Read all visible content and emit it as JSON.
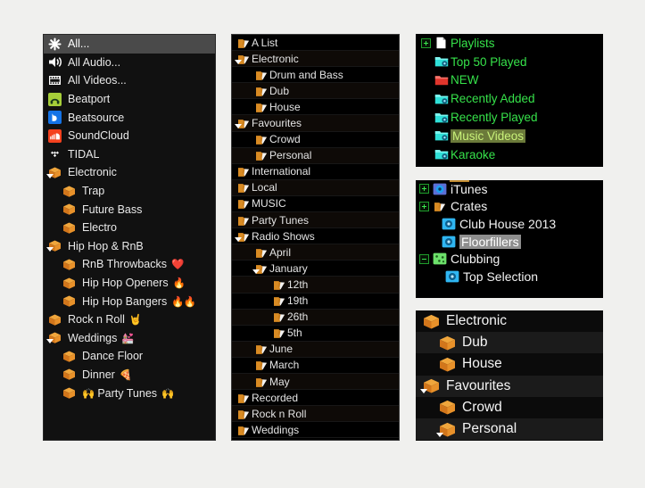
{
  "sources_panel": {
    "rows": [
      {
        "label": "All...",
        "icon": "asterisk-icon",
        "indent": 0,
        "selected": true,
        "arrow": false,
        "emoji": "",
        "emoji_pre": ""
      },
      {
        "label": "All Audio...",
        "icon": "speaker-icon",
        "indent": 0,
        "selected": false,
        "arrow": false,
        "emoji": "",
        "emoji_pre": ""
      },
      {
        "label": "All Videos...",
        "icon": "film-icon",
        "indent": 0,
        "selected": false,
        "arrow": false,
        "emoji": "",
        "emoji_pre": ""
      },
      {
        "label": "Beatport",
        "icon": "beatport-icon",
        "indent": 0,
        "selected": false,
        "arrow": false,
        "emoji": "",
        "emoji_pre": ""
      },
      {
        "label": "Beatsource",
        "icon": "beatsource-icon",
        "indent": 0,
        "selected": false,
        "arrow": false,
        "emoji": "",
        "emoji_pre": ""
      },
      {
        "label": "SoundCloud",
        "icon": "soundcloud-icon",
        "indent": 0,
        "selected": false,
        "arrow": false,
        "emoji": "",
        "emoji_pre": ""
      },
      {
        "label": "TIDAL",
        "icon": "tidal-icon",
        "indent": 0,
        "selected": false,
        "arrow": false,
        "emoji": "",
        "emoji_pre": ""
      },
      {
        "label": "Electronic",
        "icon": "crate-icon",
        "indent": 0,
        "selected": false,
        "arrow": true,
        "emoji": "",
        "emoji_pre": ""
      },
      {
        "label": "Trap",
        "icon": "crate-icon",
        "indent": 1,
        "selected": false,
        "arrow": false,
        "emoji": "",
        "emoji_pre": ""
      },
      {
        "label": "Future Bass",
        "icon": "crate-icon",
        "indent": 1,
        "selected": false,
        "arrow": false,
        "emoji": "",
        "emoji_pre": ""
      },
      {
        "label": "Electro",
        "icon": "crate-icon",
        "indent": 1,
        "selected": false,
        "arrow": false,
        "emoji": "",
        "emoji_pre": ""
      },
      {
        "label": "Hip Hop & RnB",
        "icon": "crate-icon",
        "indent": 0,
        "selected": false,
        "arrow": true,
        "emoji": "",
        "emoji_pre": ""
      },
      {
        "label": "RnB Throwbacks",
        "icon": "crate-icon",
        "indent": 1,
        "selected": false,
        "arrow": false,
        "emoji": "❤️",
        "emoji_pre": ""
      },
      {
        "label": "Hip Hop Openers",
        "icon": "crate-icon",
        "indent": 1,
        "selected": false,
        "arrow": false,
        "emoji": "🔥",
        "emoji_pre": ""
      },
      {
        "label": "Hip Hop Bangers",
        "icon": "crate-icon",
        "indent": 1,
        "selected": false,
        "arrow": false,
        "emoji": "🔥🔥",
        "emoji_pre": ""
      },
      {
        "label": "Rock n Roll",
        "icon": "crate-icon",
        "indent": 0,
        "selected": false,
        "arrow": false,
        "emoji": "🤘",
        "emoji_pre": ""
      },
      {
        "label": "Weddings",
        "icon": "crate-icon",
        "indent": 0,
        "selected": false,
        "arrow": true,
        "emoji": "💒",
        "emoji_pre": ""
      },
      {
        "label": "Dance Floor",
        "icon": "crate-icon",
        "indent": 1,
        "selected": false,
        "arrow": false,
        "emoji": "",
        "emoji_pre": ""
      },
      {
        "label": "Dinner",
        "icon": "crate-icon",
        "indent": 1,
        "selected": false,
        "arrow": false,
        "emoji": "🍕",
        "emoji_pre": ""
      },
      {
        "label": "Party Tunes",
        "icon": "crate-icon",
        "indent": 1,
        "selected": false,
        "arrow": false,
        "emoji": "🙌",
        "emoji_pre": "🙌"
      }
    ]
  },
  "crates_panel": {
    "rows": [
      {
        "label": "A List",
        "indent": 0,
        "arrow": false
      },
      {
        "label": "Electronic",
        "indent": 0,
        "arrow": true
      },
      {
        "label": "Drum and Bass",
        "indent": 1,
        "arrow": false
      },
      {
        "label": "Dub",
        "indent": 1,
        "arrow": false
      },
      {
        "label": "House",
        "indent": 1,
        "arrow": false
      },
      {
        "label": "Favourites",
        "indent": 0,
        "arrow": true
      },
      {
        "label": "Crowd",
        "indent": 1,
        "arrow": false
      },
      {
        "label": "Personal",
        "indent": 1,
        "arrow": false
      },
      {
        "label": "International",
        "indent": 0,
        "arrow": false
      },
      {
        "label": "Local",
        "indent": 0,
        "arrow": false
      },
      {
        "label": "MUSIC",
        "indent": 0,
        "arrow": false
      },
      {
        "label": "Party Tunes",
        "indent": 0,
        "arrow": false
      },
      {
        "label": "Radio Shows",
        "indent": 0,
        "arrow": true
      },
      {
        "label": "April",
        "indent": 1,
        "arrow": false
      },
      {
        "label": "January",
        "indent": 1,
        "arrow": true
      },
      {
        "label": "12th",
        "indent": 2,
        "arrow": false
      },
      {
        "label": "19th",
        "indent": 2,
        "arrow": false
      },
      {
        "label": "26th",
        "indent": 2,
        "arrow": false
      },
      {
        "label": "5th",
        "indent": 2,
        "arrow": false
      },
      {
        "label": "June",
        "indent": 1,
        "arrow": false
      },
      {
        "label": "March",
        "indent": 1,
        "arrow": false
      },
      {
        "label": "May",
        "indent": 1,
        "arrow": false
      },
      {
        "label": "Recorded",
        "indent": 0,
        "arrow": false
      },
      {
        "label": "Rock n Roll",
        "indent": 0,
        "arrow": false
      },
      {
        "label": "Weddings",
        "indent": 0,
        "arrow": false
      }
    ]
  },
  "playlists_panel": {
    "text_color": "#36e24a",
    "highlight_bg": "#6b7a3a",
    "rows": [
      {
        "label": "Playlists",
        "icon": "page-icon",
        "expander": "plus",
        "indent": 0,
        "highlighted": false
      },
      {
        "label": "Top 50 Played",
        "icon": "smart-folder-icon",
        "expander": "none",
        "indent": 1,
        "highlighted": false
      },
      {
        "label": "NEW",
        "icon": "red-folder-icon",
        "expander": "none",
        "indent": 1,
        "highlighted": false
      },
      {
        "label": "Recently Added",
        "icon": "smart-folder-icon",
        "expander": "none",
        "indent": 1,
        "highlighted": false
      },
      {
        "label": "Recently Played",
        "icon": "smart-folder-icon",
        "expander": "none",
        "indent": 1,
        "highlighted": false
      },
      {
        "label": "Music Videos",
        "icon": "smart-folder-icon",
        "expander": "none",
        "indent": 1,
        "highlighted": true
      },
      {
        "label": "Karaoke",
        "icon": "smart-folder-icon",
        "expander": "none",
        "indent": 1,
        "highlighted": false
      }
    ]
  },
  "library_panel": {
    "rows": [
      {
        "label": "iTunes",
        "icon": "itunes-icon",
        "expander": "plus",
        "indent": 0,
        "highlighted": false
      },
      {
        "label": "Crates",
        "icon": "orange-folder-icon",
        "expander": "plus",
        "indent": 0,
        "highlighted": false
      },
      {
        "label": "Club House 2013",
        "icon": "crate-disc-icon",
        "expander": "none",
        "indent": 1,
        "highlighted": false
      },
      {
        "label": "Floorfillers",
        "icon": "crate-disc-icon",
        "expander": "none",
        "indent": 1,
        "highlighted": true
      },
      {
        "label": "Clubbing",
        "icon": "green-crate-icon",
        "expander": "minus",
        "indent": 0,
        "highlighted": false
      },
      {
        "label": "Top Selection",
        "icon": "crate-disc-icon",
        "expander": "none",
        "indent": 2,
        "highlighted": false
      }
    ]
  },
  "bigcrates_panel": {
    "rows": [
      {
        "label": "Electronic",
        "indent": 0,
        "arrow": false
      },
      {
        "label": "Dub",
        "indent": 1,
        "arrow": false
      },
      {
        "label": "House",
        "indent": 1,
        "arrow": false
      },
      {
        "label": "Favourites",
        "indent": 0,
        "arrow": true
      },
      {
        "label": "Crowd",
        "indent": 1,
        "arrow": false
      },
      {
        "label": "Personal",
        "indent": 1,
        "arrow": true
      }
    ]
  }
}
